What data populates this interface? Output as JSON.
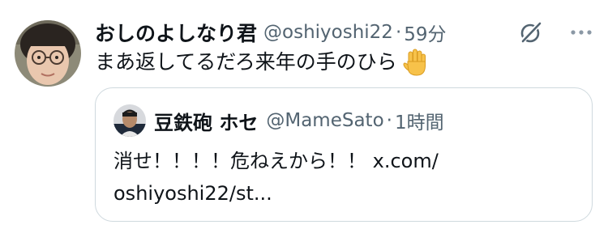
{
  "tweet": {
    "author": {
      "display_name": "おしのよしなり君",
      "handle": "@oshiyoshi22",
      "avatar_icon": "avatar-photo"
    },
    "separator": "·",
    "time": "59分",
    "text": "まあ返してるだろ来年の手のひら",
    "emoji": "raised-hand-emoji",
    "icons": [
      "grok-icon",
      "more-icon"
    ]
  },
  "quote": {
    "author": {
      "display_name": "豆鉄砲 ホセ",
      "handle": "@MameSato",
      "avatar_icon": "avatar-photo"
    },
    "separator": "·",
    "time": "1時間",
    "text_line1": "消せ！！！！危ねえから！！ x.com/",
    "text_line2": "oshiyoshi22/st..."
  },
  "colors": {
    "text": "#0f1419",
    "secondary": "#536471",
    "border": "#cfd9de"
  }
}
